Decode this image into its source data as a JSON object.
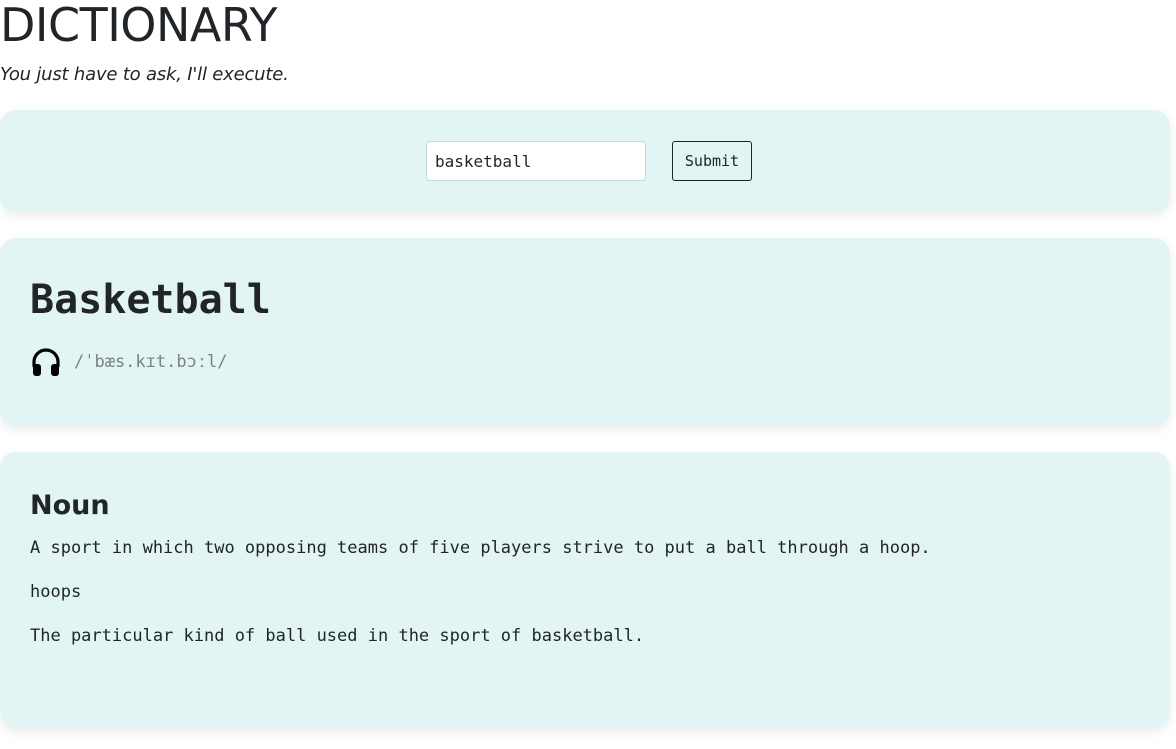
{
  "header": {
    "title": "DICTIONARY",
    "tagline": "You just have to ask, I'll execute."
  },
  "search": {
    "value": "basketball",
    "submit_label": "Submit"
  },
  "entry": {
    "word": "Basketball",
    "phonetic": "/ˈbæs.kɪt.bɔːl/",
    "audio_icon": "headphones-icon",
    "meaning": {
      "part_of_speech": "Noun",
      "definition_1": "A sport in which two opposing teams of five players strive to put a ball through a hoop.",
      "synonym": "hoops",
      "definition_2": "The particular kind of ball used in the sport of basketball."
    }
  },
  "colors": {
    "card_background": "#e2f4f4",
    "text": "#212529",
    "phonetic_text": "#7b8186"
  }
}
